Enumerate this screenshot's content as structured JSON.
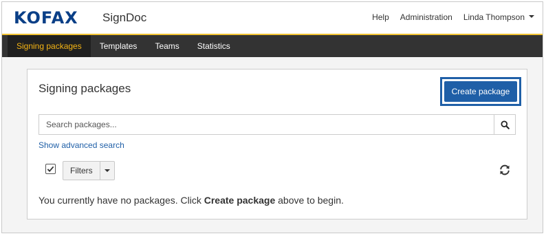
{
  "header": {
    "logo_text": "KOFAX",
    "app_name": "SignDoc",
    "links": {
      "help": "Help",
      "administration": "Administration",
      "user": "Linda Thompson"
    }
  },
  "navbar": {
    "tabs": [
      "Signing packages",
      "Templates",
      "Teams",
      "Statistics"
    ],
    "active_tab": "Signing packages"
  },
  "panel": {
    "title": "Signing packages",
    "create_button": "Create package",
    "search": {
      "placeholder": "Search packages...",
      "value": ""
    },
    "advanced_search_link": "Show advanced search",
    "filters_label": "Filters",
    "checkbox_checked": true,
    "empty_message": {
      "before": "You currently have no packages. Click ",
      "bold": "Create package",
      "after": " above to begin."
    }
  },
  "colors": {
    "brand_blue": "#0a3f87",
    "primary_button": "#1f5fa7",
    "accent_yellow": "#f5b414",
    "navbar_bg": "#333333"
  },
  "icons": {
    "search": "search-icon",
    "refresh": "refresh-icon",
    "checkmark": "checkmark-icon",
    "dropdown": "chevron-down-icon"
  }
}
